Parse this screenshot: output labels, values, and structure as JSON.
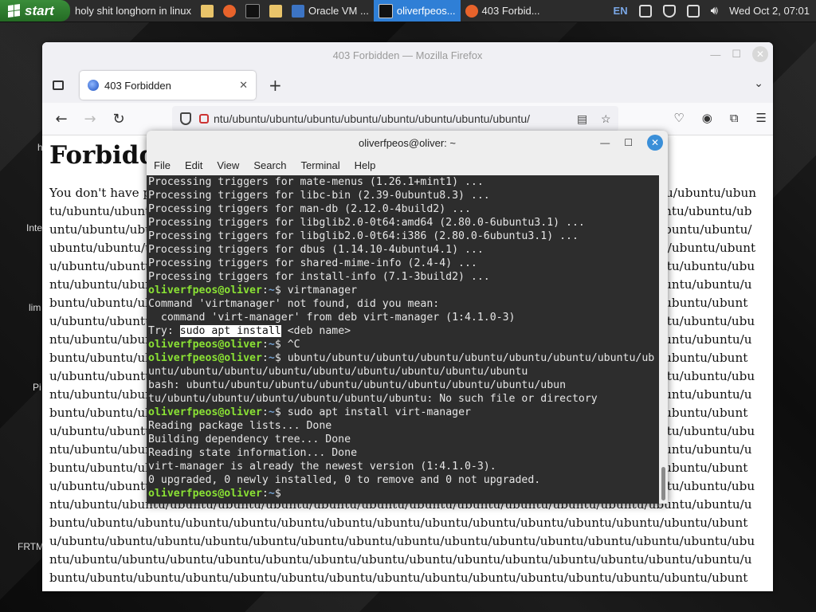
{
  "taskbar": {
    "start_label": "start",
    "tasks": [
      {
        "label": "holy shit longhorn in linux"
      },
      {
        "label": "Oracle VM ..."
      },
      {
        "label": "oliverfpeos..."
      },
      {
        "label": "403 Forbid..."
      }
    ],
    "lang": "EN",
    "clock": "Wed Oct  2, 07:01"
  },
  "desktop": {
    "labels": [
      "h",
      "Inte",
      "lim",
      "Pi",
      "FRTM"
    ]
  },
  "firefox": {
    "window_title": "403 Forbidden — Mozilla Firefox",
    "tab_title": "403 Forbidden",
    "url": "ntu/ubuntu/ubuntu/ubuntu/ubuntu/ubuntu/ubuntu/ubuntu/ubuntu/",
    "heading": "Forbidden",
    "body_prefix": "You don't have p",
    "body_repeat": "ubuntu/",
    "body_repeat_count": 340
  },
  "terminal": {
    "title": "oliverfpeos@oliver: ~",
    "menu": [
      "File",
      "Edit",
      "View",
      "Search",
      "Terminal",
      "Help"
    ],
    "prompt_user": "oliverfpeos@oliver",
    "prompt_sep": ":",
    "prompt_path": "~",
    "lines": [
      {
        "text": "Processing triggers for mate-menus (1.26.1+mint1) ..."
      },
      {
        "text": "Processing triggers for libc-bin (2.39-0ubuntu8.3) ..."
      },
      {
        "text": "Processing triggers for man-db (2.12.0-4build2) ..."
      },
      {
        "text": "Processing triggers for libglib2.0-0t64:amd64 (2.80.0-6ubuntu3.1) ..."
      },
      {
        "text": "Processing triggers for libglib2.0-0t64:i386 (2.80.0-6ubuntu3.1) ..."
      },
      {
        "text": "Processing triggers for dbus (1.14.10-4ubuntu4.1) ..."
      },
      {
        "text": "Processing triggers for shared-mime-info (2.4-4) ..."
      },
      {
        "text": "Processing triggers for install-info (7.1-3build2) ..."
      },
      {
        "prompt": true,
        "text": "$ virtmanager"
      },
      {
        "text": "Command 'virtmanager' not found, did you mean:"
      },
      {
        "text": "  command 'virt-manager' from deb virt-manager (1:4.1.0-3)"
      },
      {
        "try": true,
        "pre": "Try: ",
        "hl": "sudo apt install",
        "post": " <deb name>"
      },
      {
        "prompt": true,
        "text": "$ ^C"
      },
      {
        "prompt": true,
        "text": "$ ubuntu/ubuntu/ubuntu/ubuntu/ubuntu/ubuntu/ubuntu/ubuntu/ub"
      },
      {
        "text": "untu/ubuntu/ubuntu/ubuntu/ubuntu/ubuntu/ubuntu/ubuntu/ubuntu"
      },
      {
        "text": "bash: ubuntu/ubuntu/ubuntu/ubuntu/ubuntu/ubuntu/ubuntu/ubuntu/ubun"
      },
      {
        "text": "tu/ubuntu/ubuntu/ubuntu/ubuntu/ubuntu/ubuntu: No such file or directory"
      },
      {
        "prompt": true,
        "text": "$ sudo apt install virt-manager"
      },
      {
        "text": "Reading package lists... Done"
      },
      {
        "text": "Building dependency tree... Done"
      },
      {
        "text": "Reading state information... Done"
      },
      {
        "text": "virt-manager is already the newest version (1:4.1.0-3)."
      },
      {
        "text": "0 upgraded, 0 newly installed, 0 to remove and 0 not upgraded."
      },
      {
        "prompt": true,
        "text": "$ "
      }
    ]
  }
}
